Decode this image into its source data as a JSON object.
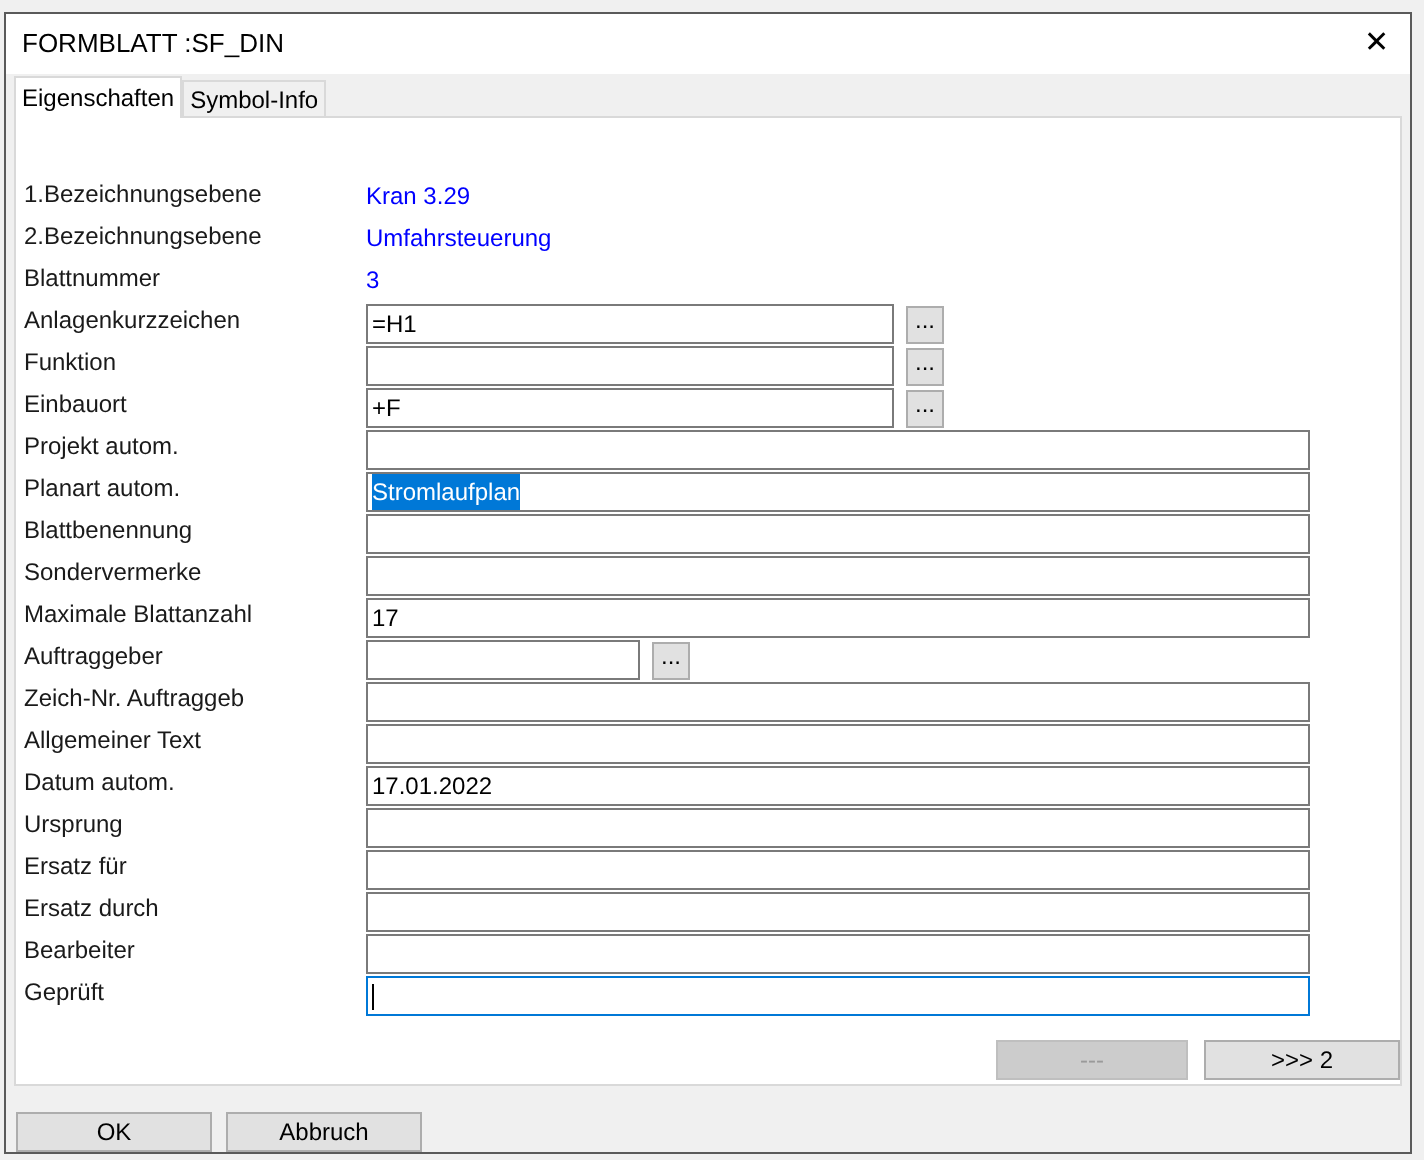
{
  "window": {
    "title": "FORMBLATT :SF_DIN",
    "close": "✕"
  },
  "tabs": [
    {
      "label": "Eigenschaften",
      "selected": true
    },
    {
      "label": "Symbol-Info",
      "selected": false
    }
  ],
  "rows": [
    {
      "kind": "value",
      "label": "1.Bezeichnungsebene",
      "value": "Kran 3.29"
    },
    {
      "kind": "value",
      "label": "2.Bezeichnungsebene",
      "value": "Umfahrsteuerung"
    },
    {
      "kind": "value",
      "label": "Blattnummer",
      "value": "3"
    },
    {
      "kind": "lookup",
      "label": "Anlagenkurzzeichen",
      "value": "=H1",
      "highlighted": false,
      "button": "...",
      "focused": false
    },
    {
      "kind": "lookup",
      "label": "Funktion",
      "button": "...",
      "focused": false
    },
    {
      "kind": "lookup",
      "label": "Einbauort",
      "value": "+F",
      "highlighted": false,
      "button": "...",
      "focused": false
    },
    {
      "kind": "input",
      "label": "Projekt autom.",
      "focused": false
    },
    {
      "kind": "input",
      "label": "Planart autom.",
      "value": "Stromlaufplan",
      "highlighted": true,
      "focused": false
    },
    {
      "kind": "input",
      "label": "Blattbenennung",
      "focused": false
    },
    {
      "kind": "input",
      "label": "Sondervermerke",
      "focused": false
    },
    {
      "kind": "input",
      "label": "Maximale Blattanzahl",
      "value": "17",
      "highlighted": false,
      "focused": false
    },
    {
      "kind": "lookup_small",
      "label": "Auftraggeber",
      "button": "...",
      "focused": false
    },
    {
      "kind": "input",
      "label": "Zeich-Nr. Auftraggeb",
      "focused": false
    },
    {
      "kind": "input",
      "label": "Allgemeiner Text",
      "focused": false
    },
    {
      "kind": "input",
      "label": "Datum autom.",
      "value": "17.01.2022",
      "highlighted": false,
      "focused": false
    },
    {
      "kind": "input",
      "label": "Ursprung",
      "focused": false
    },
    {
      "kind": "input",
      "label": "Ersatz für",
      "focused": false
    },
    {
      "kind": "input",
      "label": "Ersatz durch",
      "focused": false
    },
    {
      "kind": "input",
      "label": "Bearbeiter",
      "focused": false
    },
    {
      "kind": "input",
      "label": "Geprüft",
      "focused": true
    }
  ],
  "page_buttons": [
    {
      "label": "---",
      "disabled": true
    },
    {
      "label": ">>> 2",
      "disabled": false
    }
  ],
  "buttons": [
    {
      "label": "OK"
    },
    {
      "label": "Abbruch"
    }
  ]
}
